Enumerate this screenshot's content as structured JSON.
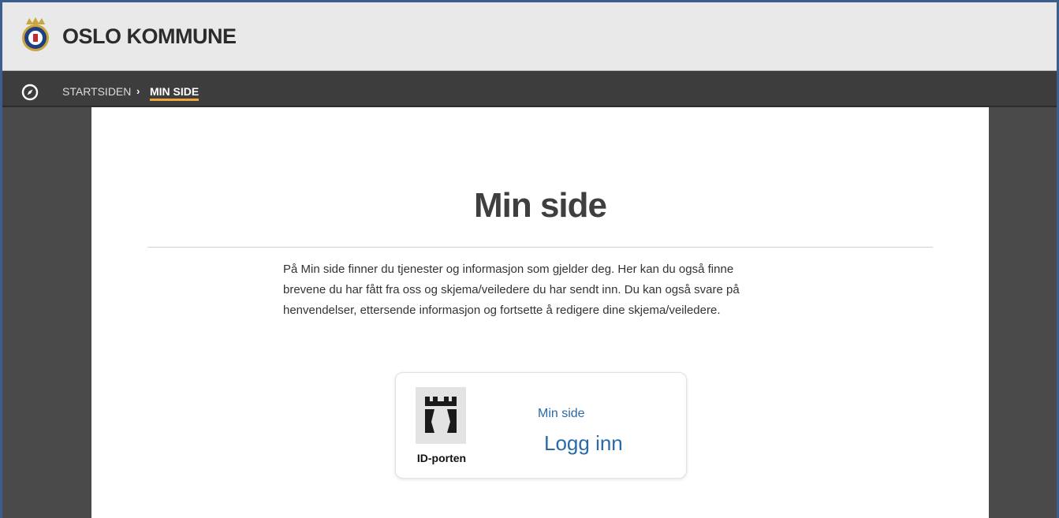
{
  "header": {
    "brand": "OSLO KOMMUNE",
    "logo_icon": "oslo-coat-of-arms"
  },
  "breadcrumb": {
    "icon": "compass-icon",
    "home": "STARTSIDEN",
    "separator": "›",
    "current": "MIN SIDE"
  },
  "main": {
    "title": "Min side",
    "intro_lines": [
      "På Min side finner du tjenester og informasjon som gjelder deg. Her kan du også finne",
      "brevene du har fått fra oss og skjema/veiledere du har sendt inn. Du kan også svare på",
      "henvendelser, ettersende informasjon og fortsette å redigere dine skjema/veiledere."
    ]
  },
  "login": {
    "provider_label": "ID-porten",
    "provider_icon": "id-porten-tower-icon",
    "subtitle": "Min side",
    "action": "Logg inn"
  },
  "colors": {
    "accent": "#f0a63a",
    "link": "#2a6aa6",
    "header_bg": "#e9e9e9",
    "nav_bg": "#3d3d3d"
  }
}
